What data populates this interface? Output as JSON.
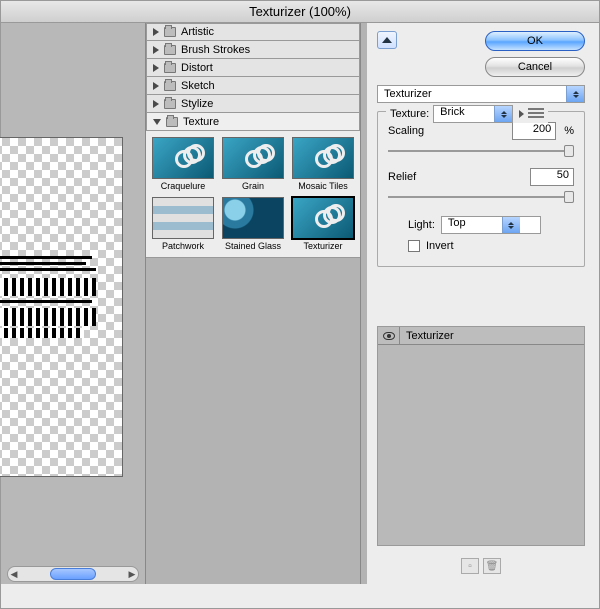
{
  "window": {
    "title": "Texturizer (100%)"
  },
  "buttons": {
    "ok": "OK",
    "cancel": "Cancel"
  },
  "categories": [
    {
      "label": "Artistic",
      "open": false
    },
    {
      "label": "Brush Strokes",
      "open": false
    },
    {
      "label": "Distort",
      "open": false
    },
    {
      "label": "Sketch",
      "open": false
    },
    {
      "label": "Stylize",
      "open": false
    },
    {
      "label": "Texture",
      "open": true,
      "items": [
        "Craquelure",
        "Grain",
        "Mosaic Tiles",
        "Patchwork",
        "Stained Glass",
        "Texturizer"
      ],
      "selected": "Texturizer"
    }
  ],
  "settings": {
    "filter_name": "Texturizer",
    "texture_label": "Texture:",
    "texture_value": "Brick",
    "scaling_label": "Scaling",
    "scaling_value": "200",
    "percent": "%",
    "relief_label": "Relief",
    "relief_value": "50",
    "light_label": "Light:",
    "light_value": "Top",
    "invert_label": "Invert",
    "invert_checked": false
  },
  "layers": [
    "Texturizer"
  ]
}
